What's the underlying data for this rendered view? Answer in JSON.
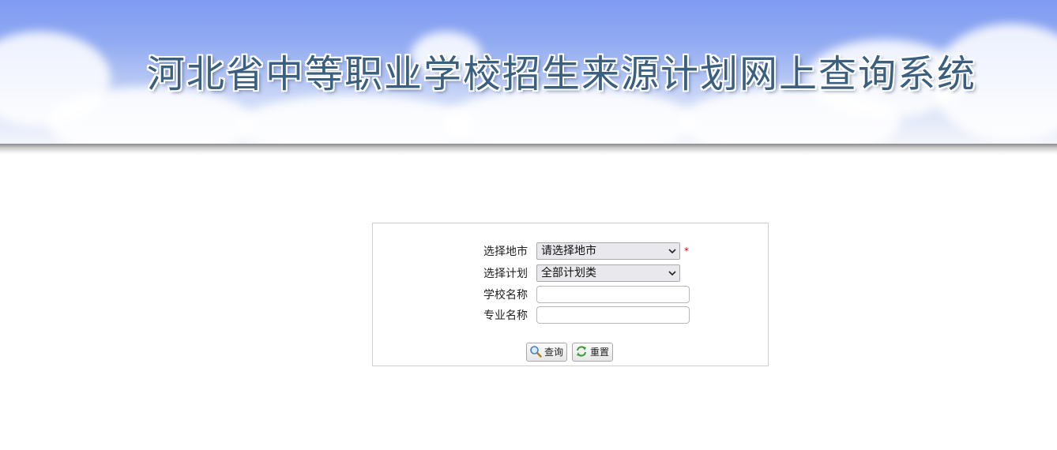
{
  "header": {
    "title": "河北省中等职业学校招生来源计划网上查询系统"
  },
  "form": {
    "city": {
      "label": "选择地市",
      "selected": "请选择地市",
      "required_mark": "*"
    },
    "plan": {
      "label": "选择计划",
      "selected": "全部计划类"
    },
    "school": {
      "label": "学校名称",
      "value": ""
    },
    "major": {
      "label": "专业名称",
      "value": ""
    },
    "buttons": {
      "search_label": "查询",
      "reset_label": "重置"
    }
  },
  "icons": {
    "search": "magnifier-icon",
    "reset": "refresh-icon",
    "dropdown": "chevron-down-icon"
  },
  "colors": {
    "banner_sky": "#7f9bf2",
    "title_text": "#3b5f7e",
    "required": "#cc0000",
    "panel_border": "#cfcfcf"
  }
}
